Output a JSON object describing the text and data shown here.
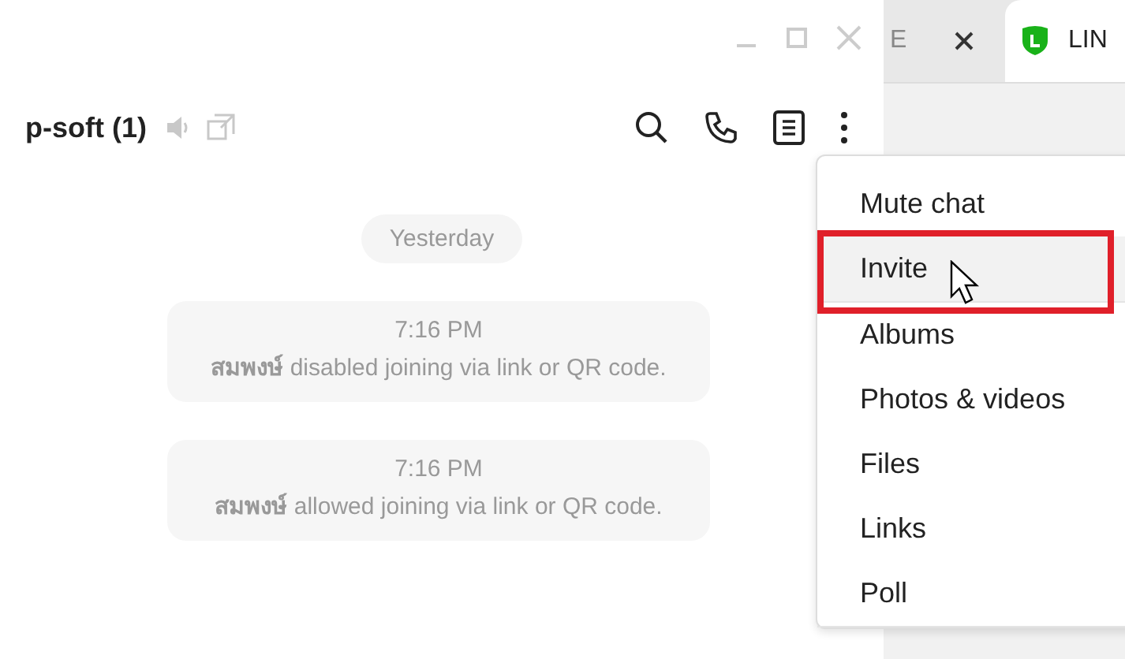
{
  "window": {
    "title": "p-soft (1)"
  },
  "browser_tabs": [
    {
      "label": "E",
      "selected": false
    },
    {
      "label": "LIN",
      "selected": true
    }
  ],
  "chat": {
    "date": "Yesterday",
    "messages": [
      {
        "time": "7:16 PM",
        "text": "**สมพงษ์** disabled joining via link or QR code."
      },
      {
        "time": "7:16 PM",
        "text": "**สมพงษ์** allowed joining via link or QR code."
      }
    ]
  },
  "menu": {
    "items": [
      {
        "label": "Mute chat",
        "selected": false,
        "annotated": false,
        "divider_after": false
      },
      {
        "label": "Invite",
        "selected": true,
        "annotated": true,
        "divider_after": true
      },
      {
        "label": "Albums",
        "selected": false,
        "annotated": false,
        "divider_after": false
      },
      {
        "label": "Photos & videos",
        "selected": false,
        "annotated": false,
        "divider_after": false
      },
      {
        "label": "Files",
        "selected": false,
        "annotated": false,
        "divider_after": false
      },
      {
        "label": "Links",
        "selected": false,
        "annotated": false,
        "divider_after": false
      },
      {
        "label": "Poll",
        "selected": false,
        "annotated": false,
        "divider_after": true
      }
    ]
  }
}
